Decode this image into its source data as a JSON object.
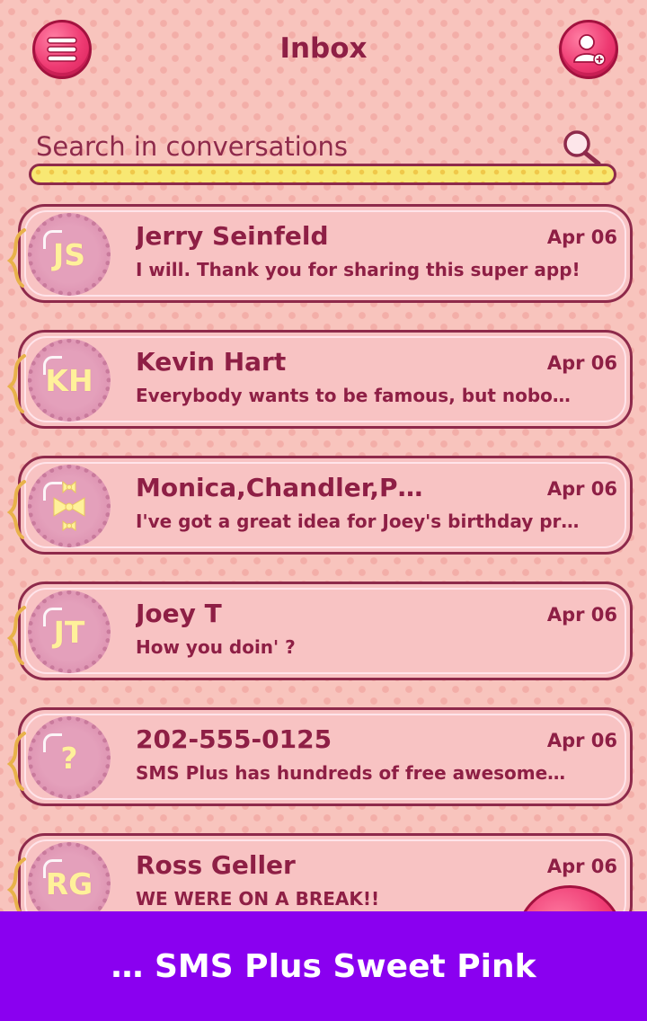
{
  "header": {
    "title": "Inbox",
    "menu_icon": "hamburger-menu-icon",
    "contact_icon": "add-contact-icon"
  },
  "search": {
    "placeholder": "Search in conversations",
    "icon": "search-icon"
  },
  "conversations": [
    {
      "avatar": "JS",
      "name": "Jerry Seinfeld",
      "date": "Apr 06",
      "preview": "I will. Thank you for sharing this super app!"
    },
    {
      "avatar": "KH",
      "name": "Kevin Hart",
      "date": "Apr 06",
      "preview": "Everybody wants to be famous, but nobo…"
    },
    {
      "avatar": "",
      "avatar_icon": "bow-group-icon",
      "name": "Monica,Chandler,P…",
      "date": "Apr 06",
      "preview": "I've got a great idea for Joey's birthday pr…"
    },
    {
      "avatar": "JT",
      "name": "Joey T",
      "date": "Apr 06",
      "preview": "How you doin' ?"
    },
    {
      "avatar": "?",
      "name": "202-555-0125",
      "date": "Apr 06",
      "preview": "SMS Plus has hundreds of free awesome…"
    },
    {
      "avatar": "RG",
      "name": "Ross Geller",
      "date": "Apr 06",
      "preview": "WE WERE ON  A BREAK!!"
    }
  ],
  "banner": {
    "text": "… SMS Plus Sweet Pink"
  },
  "colors": {
    "accent": "#ee3a72",
    "text": "#8e1f45",
    "background": "#f8c4bd",
    "banner": "#8a00f0",
    "avatar_initials": "#fff19a"
  }
}
